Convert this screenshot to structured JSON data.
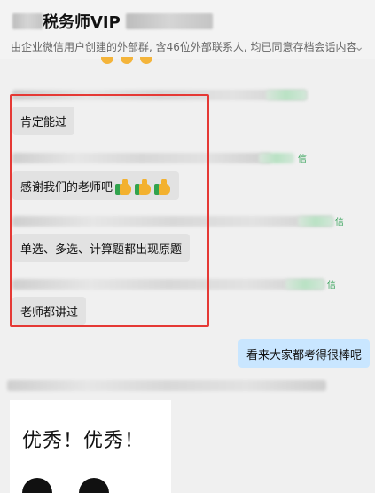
{
  "header": {
    "title": "税务师VIP",
    "subtitle": "由企业微信用户创建的外部群, 含46位外部联系人, 均已同意存档会话内容",
    "chevron": "chevron-down-icon"
  },
  "messages": [
    {
      "text": "肯定能过"
    },
    {
      "text": "感谢我们的老师吧",
      "emoji": [
        "thumbs-up-icon",
        "thumbs-up-icon",
        "thumbs-up-icon"
      ]
    },
    {
      "text": "单选、多选、计算题都出现原题"
    },
    {
      "text": "老师都讲过"
    },
    {
      "text": "看来大家都考得很棒呢",
      "self": true
    },
    {
      "image_text": "优秀！优秀！"
    }
  ],
  "sender_notes": [
    "信",
    "信",
    "信"
  ],
  "colors": {
    "self_bubble": "#c9e6ff",
    "other_bubble": "#e2e2e2",
    "highlight_border": "#e53935",
    "wechat_green": "#38a35b"
  }
}
